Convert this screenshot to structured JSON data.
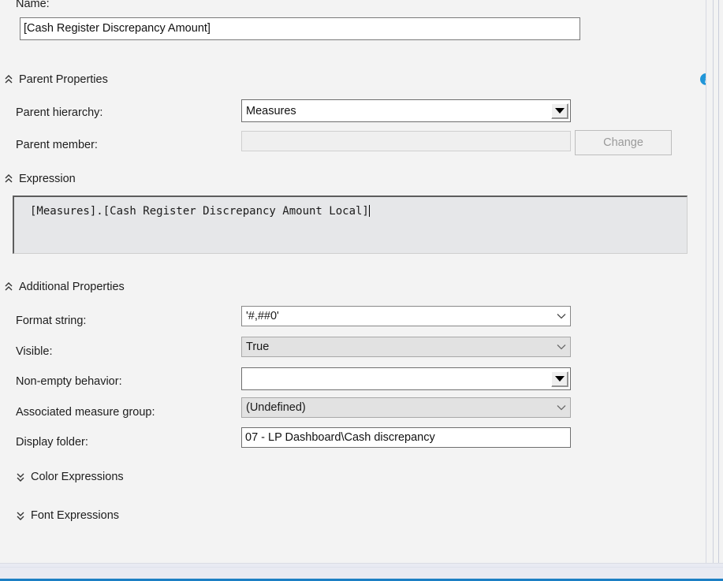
{
  "form": {
    "name_label": "Name:",
    "name_value": "[Cash Register Discrepancy Amount]"
  },
  "parent_properties": {
    "section_title": "Parent Properties",
    "expanded": true,
    "hierarchy_label": "Parent hierarchy:",
    "hierarchy_value": "Measures",
    "member_label": "Parent member:",
    "member_value": "",
    "change_button": "Change"
  },
  "expression": {
    "section_title": "Expression",
    "expanded": true,
    "value": "[Measures].[Cash Register Discrepancy Amount Local]"
  },
  "additional_properties": {
    "section_title": "Additional Properties",
    "expanded": true,
    "format_string_label": "Format string:",
    "format_string_value": "'#,##0'",
    "visible_label": "Visible:",
    "visible_value": "True",
    "non_empty_label": "Non-empty behavior:",
    "non_empty_value": "",
    "measure_group_label": "Associated measure group:",
    "measure_group_value": "(Undefined)",
    "display_folder_label": "Display folder:",
    "display_folder_value": "07 - LP Dashboard\\Cash discrepancy"
  },
  "color_expressions": {
    "section_title": "Color Expressions",
    "expanded": false
  },
  "font_expressions": {
    "section_title": "Font Expressions",
    "expanded": false
  },
  "icons": {
    "info": "info-icon",
    "chevron_up_double": "chevron-up-double-icon",
    "chevron_down_double": "chevron-down-double-icon",
    "dropdown_arrow": "dropdown-arrow-icon"
  },
  "colors": {
    "panel_bg": "#f3f3f3",
    "accent_blue": "#1b7fc4",
    "info_blue": "#2196d8",
    "field_bg": "#ffffff",
    "disabled_bg": "#e2e2e2",
    "expression_bg": "#e6e7e9"
  }
}
